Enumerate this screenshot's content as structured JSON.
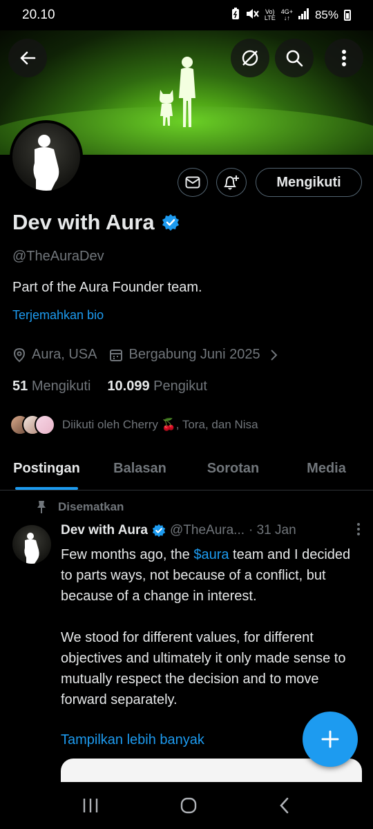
{
  "status_bar": {
    "time": "20.10",
    "network_top": "Vo)",
    "network_bottom": "LTE",
    "data_top": "4G+",
    "data_bottom": "↓↑",
    "battery": "85%"
  },
  "header_icons": {
    "back": "arrow-left-icon",
    "grok": "grok-icon",
    "search": "search-icon",
    "more": "more-vertical-icon"
  },
  "profile": {
    "name": "Dev with Aura",
    "handle": "@TheAuraDev",
    "bio": "Part of the Aura Founder team.",
    "translate_bio": "Terjemahkan bio",
    "location": "Aura, USA",
    "joined": "Bergabung Juni 2025",
    "following_count": "51",
    "following_label": "Mengikuti",
    "followers_count": "10.099",
    "followers_label": "Pengikut",
    "followed_by": "Diikuti oleh Cherry 🍒, Tora, dan Nisa",
    "follow_button": "Mengikuti"
  },
  "tabs": [
    {
      "label": "Postingan"
    },
    {
      "label": "Balasan"
    },
    {
      "label": "Sorotan"
    },
    {
      "label": "Media"
    }
  ],
  "pinned_post": {
    "pinned_label": "Disematkan",
    "author_name": "Dev with Aura",
    "author_handle": "@TheAura...",
    "date": "· 31 Jan",
    "text_before_tag": "Few months ago, the ",
    "cashtag": "$aura",
    "text_after_tag": " team and I decided to parts ways, not because of a conflict, but because of a change in interest.\n\nWe stood for different values, for different objectives and ultimately it only made sense to mutually respect the decision and to move forward separately.",
    "show_more": "Tampilkan lebih banyak"
  },
  "colors": {
    "accent": "#1d9bf0",
    "background": "#000000",
    "text_primary": "#e7e9ea",
    "text_secondary": "#71767b"
  }
}
